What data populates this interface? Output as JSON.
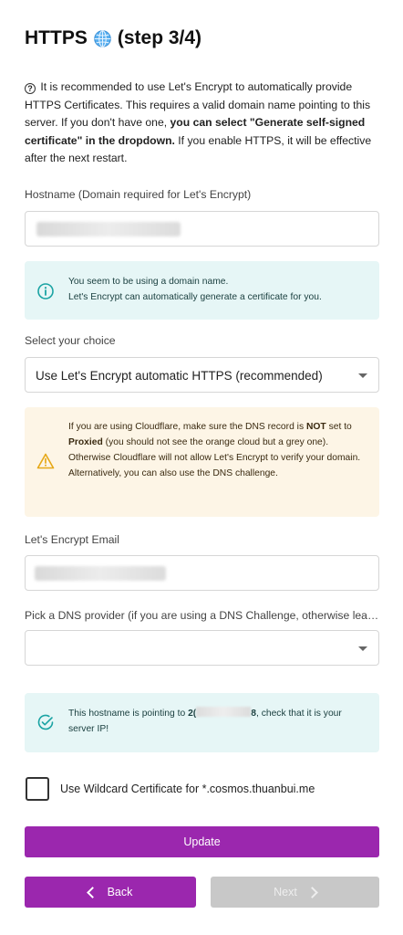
{
  "header": {
    "title_prefix": "HTTPS",
    "title_suffix": "(step 3/4)",
    "title_icon": "globe-icon"
  },
  "intro": {
    "icon": "question-circle-icon",
    "part1": "It is recommended to use Let's Encrypt to automatically provide HTTPS Certificates. This requires a valid domain name pointing to this server. If you don't have one, ",
    "bold": "you can select \"Generate self-signed certificate\" in the dropdown.",
    "part2": " If you enable HTTPS, it will be effective after the next restart."
  },
  "hostname": {
    "label": "Hostname (Domain required for Let's Encrypt)",
    "value_redacted": true
  },
  "domain_alert": {
    "icon": "info-circle-icon",
    "line1": "You seem to be using a domain name.",
    "line2": "Let's Encrypt can automatically generate a certificate for you."
  },
  "choice": {
    "label": "Select your choice",
    "selected": "Use Let's Encrypt automatic HTTPS (recommended)"
  },
  "cloudflare_alert": {
    "icon": "warning-triangle-icon",
    "t1": "If you are using Cloudflare, make sure the DNS record is ",
    "b1": "NOT",
    "t2": " set to ",
    "b2": "Proxied",
    "t3": " (you should not see the orange cloud but a grey one). Otherwise Cloudflare will not allow Let's Encrypt to verify your domain.",
    "line2": "Alternatively, you can also use the DNS challenge."
  },
  "email": {
    "label": "Let's Encrypt Email",
    "value_redacted": true
  },
  "dns_provider": {
    "label": "Pick a DNS provider (if you are using a DNS Challenge, otherwise leave empty)",
    "selected": ""
  },
  "ip_alert": {
    "icon": "check-circle-icon",
    "prefix": "This hostname is pointing to ",
    "ip_start": "2(",
    "ip_end": "8",
    "suffix": ", check that it is your server IP!"
  },
  "wildcard": {
    "label": "Use Wildcard Certificate for *.cosmos.thuanbui.me",
    "checked": false
  },
  "buttons": {
    "update": "Update",
    "back": "Back",
    "next": "Next"
  },
  "colors": {
    "accent": "#9b27ae",
    "disabled": "#c8c8c8",
    "info_bg": "#e6f6f6",
    "warn_bg": "#fdf5e6",
    "info_icon": "#1aa3a3",
    "warn_icon": "#e6a817"
  }
}
